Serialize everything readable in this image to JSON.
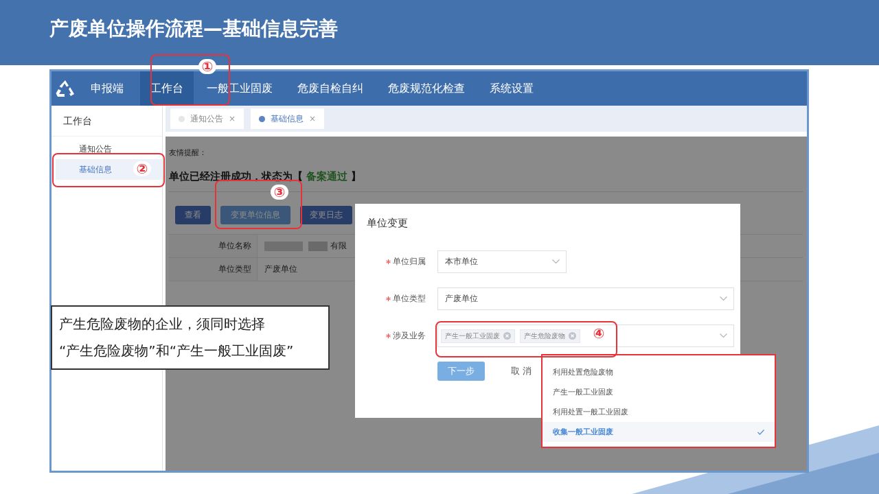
{
  "slide": {
    "title": "产废单位操作流程—基础信息完善"
  },
  "app": {
    "brand": "申报端",
    "nav": [
      {
        "label": "工作台",
        "selected": true
      },
      {
        "label": "一般工业固废",
        "selected": false
      },
      {
        "label": "危废自检自纠",
        "selected": false
      },
      {
        "label": "危废规范化检查",
        "selected": false
      },
      {
        "label": "系统设置",
        "selected": false
      }
    ],
    "sidebar": {
      "heading": "工作台",
      "items": [
        {
          "label": "通知公告",
          "selected": false
        },
        {
          "label": "基础信息",
          "selected": true
        }
      ]
    },
    "tabs": [
      {
        "label": "通知公告",
        "selected": false,
        "close": "×"
      },
      {
        "label": "基础信息",
        "selected": true,
        "close": "×"
      }
    ],
    "page": {
      "reminder": "友情提醒：",
      "status_prefix": "单位已经注册成功，状态为【 ",
      "status": "备案通过",
      "status_suffix": " 】",
      "buttons": [
        {
          "label": "查看",
          "highlighted": false
        },
        {
          "label": "变更单位信息",
          "highlighted": true
        },
        {
          "label": "变更日志",
          "highlighted": false
        }
      ],
      "rows": [
        {
          "label": "单位名称",
          "value": "有限",
          "redacted": true
        },
        {
          "label": "单位类型",
          "value": "产废单位",
          "redacted": false
        }
      ]
    },
    "modal": {
      "title": "单位变更",
      "fields": [
        {
          "kind": "select",
          "label": "单位归属",
          "required": true,
          "value": "本市单位"
        },
        {
          "kind": "select",
          "label": "单位类型",
          "required": true,
          "value": "产废单位"
        },
        {
          "kind": "tags",
          "label": "涉及业务",
          "required": true,
          "tags": [
            "产生一般工业固废",
            "产生危险废物"
          ]
        }
      ],
      "buttons": [
        {
          "kind": "primary",
          "label": "下一步"
        },
        {
          "kind": "text",
          "label": "取 消"
        }
      ]
    },
    "dropdown": {
      "options": [
        {
          "label": "利用处置危险废物",
          "selected": false
        },
        {
          "label": "产生一般工业固废",
          "selected": false
        },
        {
          "label": "利用处置一般工业固废",
          "selected": false
        },
        {
          "label": "收集一般工业固废",
          "selected": true
        }
      ]
    }
  },
  "annotations": [
    "①",
    "②",
    "③",
    "④"
  ],
  "callout": {
    "lines": [
      "产生危险废物的企业，须同时选择",
      "“产生危险废物”和“产生一般工业固废”"
    ]
  }
}
